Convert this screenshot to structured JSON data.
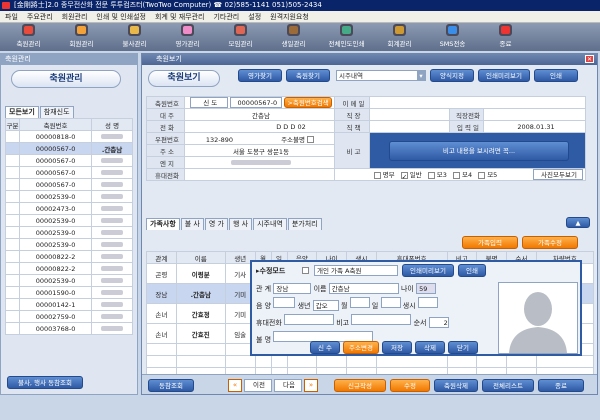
{
  "app": {
    "title": "[金剛將士]2.0 종무전산화 전문 투투컴즈터(TwoTwo Computer) ☎ 02)585-1141 051)505-2434"
  },
  "menu": [
    "파일",
    "주요관리",
    "회원관리",
    "인쇄 및 인쇄설정",
    "회계 및 재무관리",
    "기타관리",
    "설정",
    "원격지원요청"
  ],
  "toolbar": [
    {
      "label": "축원관리",
      "color": "#e84a3c"
    },
    {
      "label": "회원관리",
      "color": "#f3a23a"
    },
    {
      "label": "불사관리",
      "color": "#e8b84a"
    },
    {
      "label": "영가관리",
      "color": "#f08cc8"
    },
    {
      "label": "모임관리",
      "color": "#d65"
    },
    {
      "label": "생일관리",
      "color": "#9b6b3a"
    },
    {
      "label": "전체인도인쇄",
      "color": "#4a8"
    },
    {
      "label": "회계관리",
      "color": "#c93"
    },
    {
      "label": "SMS전송",
      "color": "#3a8de8"
    },
    {
      "label": "종료",
      "color": "#e33"
    }
  ],
  "left": {
    "window_title": "축원관리",
    "heading": "축원관리",
    "tabs": [
      "모든보기",
      "참재신도"
    ],
    "headers": [
      "구분",
      "축원번호",
      "성    명"
    ],
    "rows": [
      {
        "no": "00000818-0",
        "name": "",
        "sel": false
      },
      {
        "no": "00000567-0",
        "name": ".간층남",
        "sel": true
      },
      {
        "no": "00000567-0",
        "name": "",
        "sel": false
      },
      {
        "no": "00000567-0",
        "name": "",
        "sel": false
      },
      {
        "no": "00000567-0",
        "name": "",
        "sel": false
      },
      {
        "no": "00002539-0",
        "name": "",
        "sel": false
      },
      {
        "no": "00002473-0",
        "name": "",
        "sel": false
      },
      {
        "no": "00002539-0",
        "name": "",
        "sel": false
      },
      {
        "no": "00002539-0",
        "name": "",
        "sel": false
      },
      {
        "no": "00002539-0",
        "name": "",
        "sel": false
      },
      {
        "no": "00000822-2",
        "name": "",
        "sel": false
      },
      {
        "no": "00000822-2",
        "name": "",
        "sel": false
      },
      {
        "no": "00002539-0",
        "name": "",
        "sel": false
      },
      {
        "no": "00001590-0",
        "name": "",
        "sel": false
      },
      {
        "no": "00000142-1",
        "name": "",
        "sel": false
      },
      {
        "no": "00002759-0",
        "name": "",
        "sel": false
      },
      {
        "no": "00003768-0",
        "name": "",
        "sel": false
      }
    ],
    "bottom_button": "불사, 행사 동참조회"
  },
  "main": {
    "window_title": "축원보기",
    "heading": "축원보기",
    "btns": [
      "영가찾기",
      "축원찾기"
    ],
    "combo": "시주내역",
    "btns2": [
      "양식지정",
      "인쇄미리보기",
      "인쇄"
    ],
    "form": {
      "l_no": "축원번호",
      "no_kind": "신 도",
      "no_val": "00000567-0",
      "search": ">축원번호검색",
      "l_email": "이 메 일",
      "l_head": "대    주",
      "head": "간층남",
      "l_job": "직    장",
      "l_jobtel": "직장전화",
      "l_tel": "전    화",
      "l_ddd": "D D D",
      "ddd": "02",
      "l_pos": "직    책",
      "l_reg": "입 력 일",
      "reg": "2008.01.31",
      "l_zip": "우편번호",
      "zip": "132-890",
      "l_addrok": "주소불명",
      "l_addr": "주    소",
      "addr": "서울 도봉구 쌍문1동",
      "l_note": "비    고",
      "note_btn": "비고 내용을 보시려면 꼭...",
      "l_engi": "엔    지",
      "l_cell": "휴대전화",
      "chk": [
        "명부",
        "일반",
        "모3",
        "모4",
        "모5"
      ],
      "photo_btn": "사진모두보기"
    },
    "subtabs": [
      "가족사항",
      "불 사",
      "영 가",
      "행 사",
      "시주내역",
      "분가처리"
    ],
    "sub_btns": [
      "가족입력",
      "가족수정"
    ],
    "fam_headers": [
      "관계",
      "이름",
      "생년",
      "월",
      "일",
      "음양",
      "나이",
      "생시",
      "휴대폰번호",
      "비고",
      "불명",
      "순서",
      "차량번호"
    ],
    "fam_rows": [
      [
        "곤령",
        "이령분",
        "기사"
      ],
      [
        "장남",
        ".간층남",
        "기미"
      ],
      [
        "손녀",
        "간효정",
        "기미"
      ],
      [
        "손녀",
        "간효진",
        "임술"
      ]
    ],
    "edit": {
      "title": "수정모드",
      "chk": "개인 가족 A축원",
      "pbtn": "인쇄미리보기",
      "print": "인쇄",
      "l_rel": "관    계",
      "rel": "장남",
      "l_name": "이름",
      "name": "간층남",
      "l_age": "나이",
      "age": "59",
      "l_lunar": "음    양",
      "l_birth": "생년",
      "birth": "갑오",
      "l_m": "월",
      "l_d": "일",
      "l_time": "생시",
      "l_cell": "휴대전화",
      "l_note": "비고",
      "l_ord": "순서",
      "ord": "2",
      "l_bm": "불    명",
      "btns": [
        "신 수",
        "주소변경",
        "저장",
        "삭제",
        "닫기"
      ]
    },
    "footer": [
      "동참조회",
      "이전",
      "다음",
      "신규작성",
      "수정",
      "축원삭제",
      "전체리스트",
      "종료"
    ]
  }
}
